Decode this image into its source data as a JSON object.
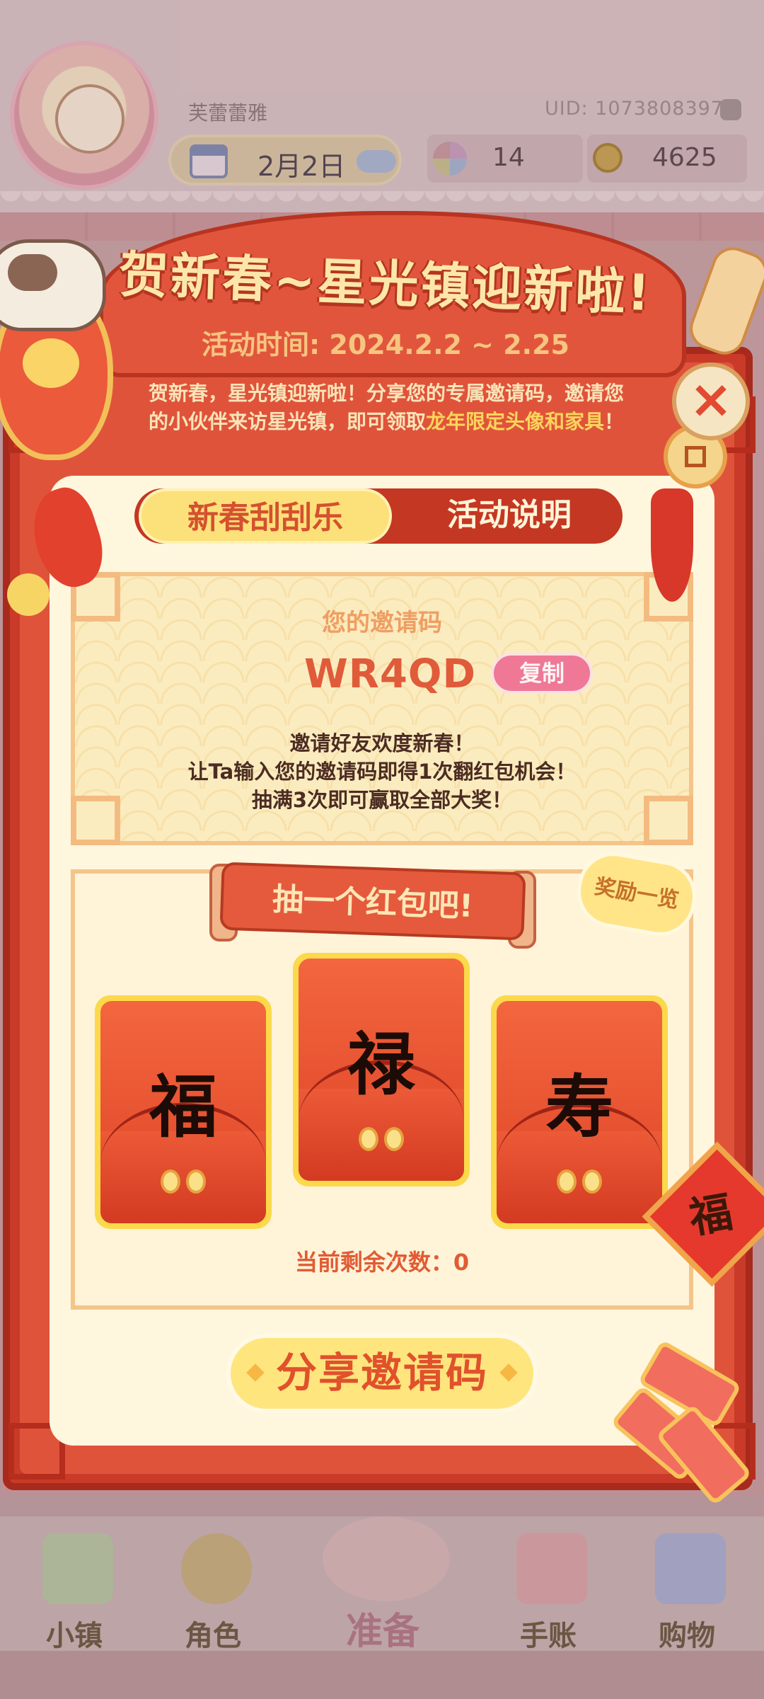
{
  "hud": {
    "player_name": "芙蕾蕾雅",
    "uid": "UID: 1073808397",
    "date": "2月2日",
    "flowers": "14",
    "coins": "4625"
  },
  "event": {
    "title": "贺新春~星光镇迎新啦!",
    "time": "活动时间: 2024.2.2 ~ 2.25",
    "intro_part1": "贺新春，星光镇迎新啦！分享您的专属邀请码，邀请您的小伙伴来访星光镇，即可领取",
    "intro_highlight": "龙年限定头像和家具",
    "intro_part2": "！",
    "close_label": "×",
    "tabs": [
      {
        "label": "新春刮刮乐",
        "active": true
      },
      {
        "label": "活动说明",
        "active": false
      }
    ],
    "invite": {
      "label": "您的邀请码",
      "code": "WR4QD",
      "copy_label": "复制",
      "desc_line1": "邀请好友欢度新春！",
      "desc_line2": "让Ta输入您的邀请码即得1次翻红包机会！",
      "desc_line3": "抽满3次即可赢取全部大奖！"
    },
    "draw": {
      "banner": "抽一个红包吧!",
      "reward_list": "奖励一览",
      "envelopes": [
        "福",
        "禄",
        "寿"
      ],
      "remaining": "当前剩余次数：0"
    },
    "share_label": "分享邀请码",
    "knot_char": "福"
  },
  "nav": {
    "items": [
      {
        "label": "小镇",
        "icon": "map-icon"
      },
      {
        "label": "角色",
        "icon": "character-icon"
      },
      {
        "label": "准备",
        "icon": "basket-icon",
        "active": true
      },
      {
        "label": "手账",
        "icon": "journal-icon"
      },
      {
        "label": "购物",
        "icon": "shopping-bag-icon"
      }
    ]
  },
  "colors": {
    "popup_red": "#e0533b",
    "gold": "#fce07a",
    "cream": "#fff6de",
    "accent_pink": "#ee7896"
  }
}
